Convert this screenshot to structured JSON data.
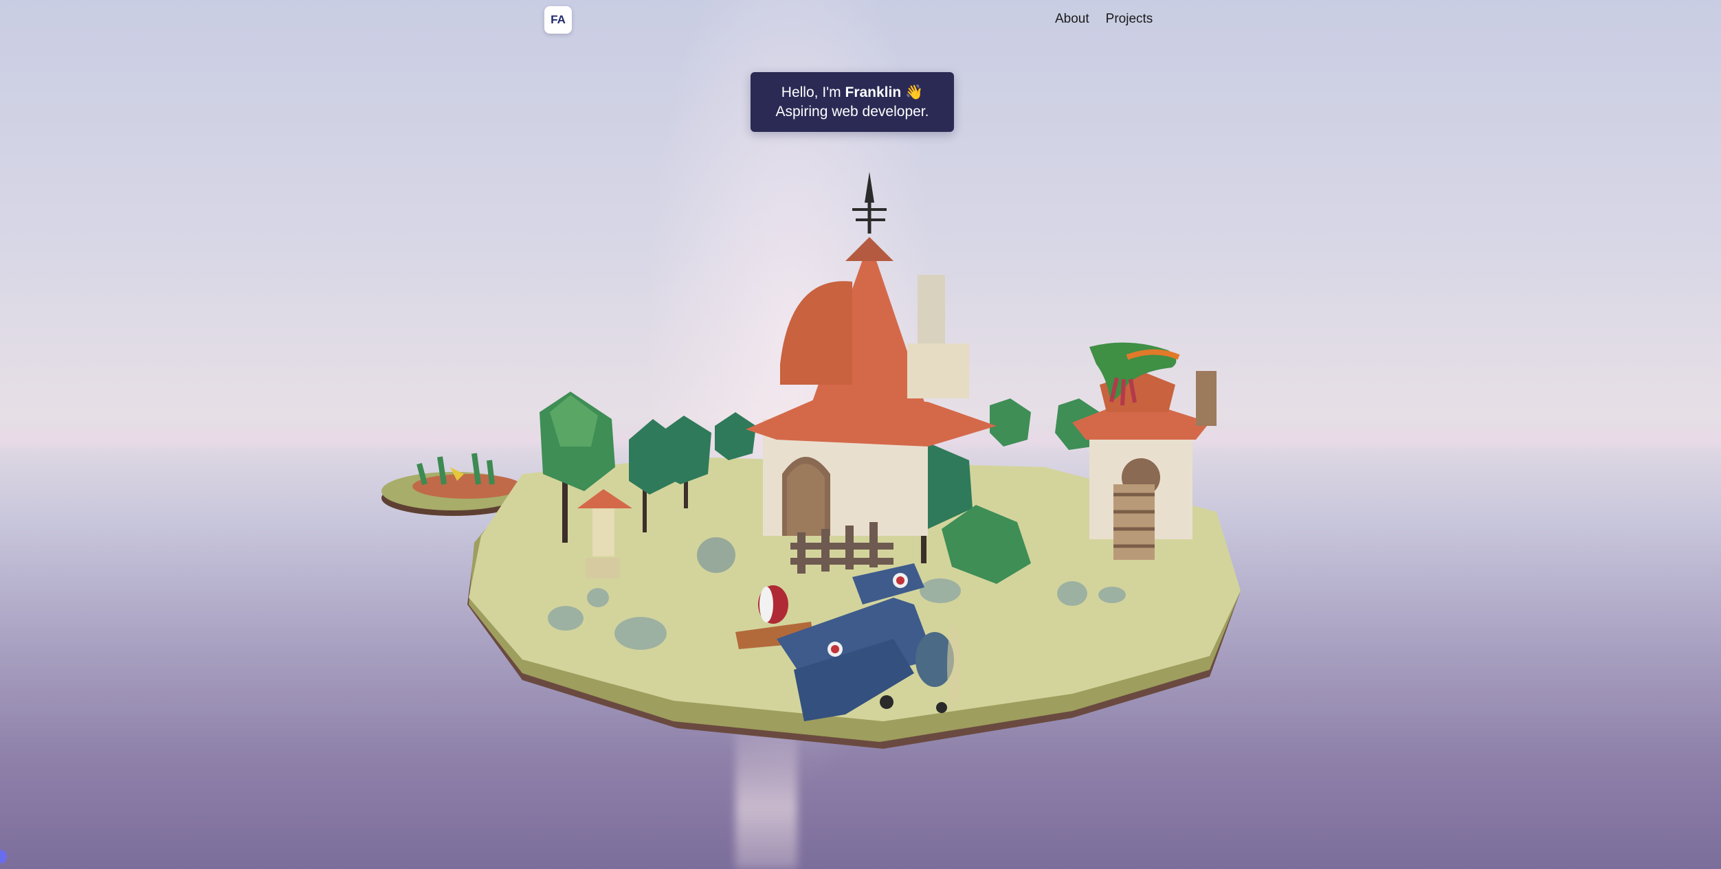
{
  "nav": {
    "logo_text": "FA",
    "links": [
      {
        "label": "About"
      },
      {
        "label": "Projects"
      }
    ]
  },
  "hero": {
    "greeting_prefix": "Hello, I'm ",
    "name": "Franklin",
    "wave_emoji": "👋",
    "tagline": "Aspiring web developer."
  },
  "colors": {
    "card_bg": "#2a2a55",
    "island_top": "#d2d39b",
    "roof": "#d4694a",
    "plane_blue": "#3e5b8c"
  }
}
